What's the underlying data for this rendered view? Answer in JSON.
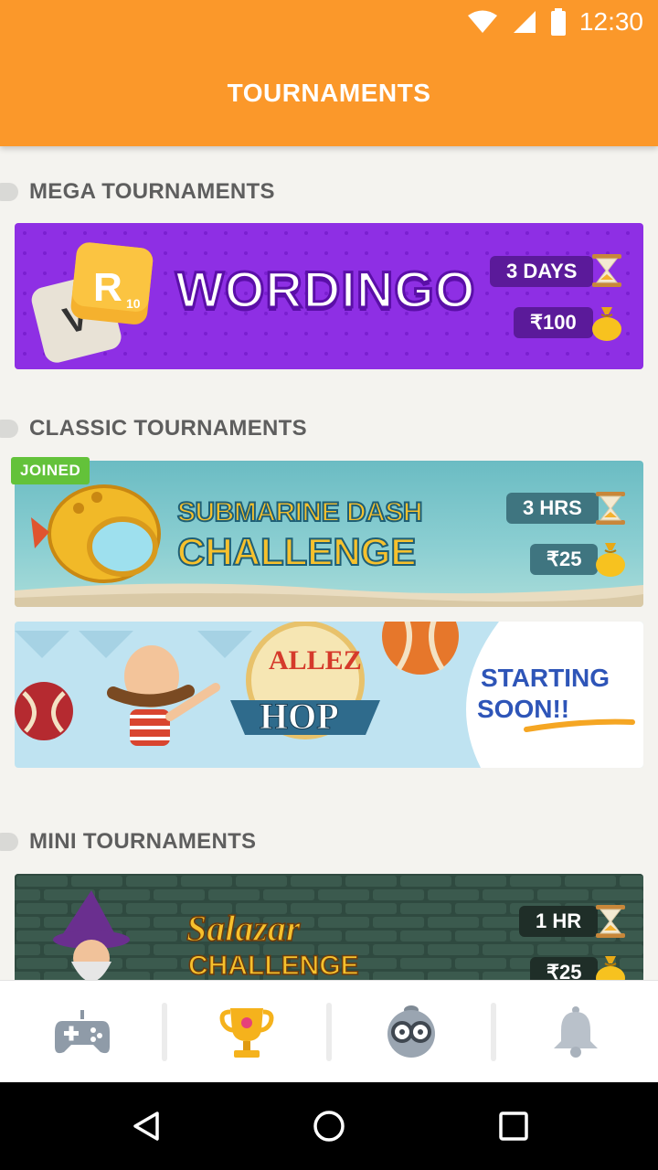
{
  "status_bar": {
    "time": "12:30"
  },
  "app_bar": {
    "title": "TOURNAMENTS"
  },
  "sections": {
    "mega": {
      "title": "MEGA TOURNAMENTS"
    },
    "classic": {
      "title": "CLASSIC TOURNAMENTS"
    },
    "mini": {
      "title": "MINI TOURNAMENTS"
    }
  },
  "cards": {
    "wordingo": {
      "logo_text": "WORDINGO",
      "tile_letter": "R",
      "tile_score": "10",
      "duration": "3 DAYS",
      "prize": "₹100"
    },
    "submarine": {
      "badge": "JOINED",
      "title_line1": "SUBMARINE DASH",
      "title_line2": "CHALLENGE",
      "duration": "3 HRS",
      "prize": "₹25"
    },
    "allez_hop": {
      "title_line1": "ALLEZ",
      "title_line2": "HOP",
      "status_line1": "STARTING",
      "status_line2": "SOON!!"
    },
    "salazar": {
      "title_line1": "Salazar",
      "title_line2": "CHALLENGE",
      "duration": "1 HR",
      "prize": "₹25"
    }
  },
  "bottom_nav": {
    "items": [
      {
        "name": "games",
        "icon": "gamepad-icon"
      },
      {
        "name": "tournaments",
        "icon": "trophy-icon",
        "active": true
      },
      {
        "name": "profile",
        "icon": "avatar-glasses-icon"
      },
      {
        "name": "notifications",
        "icon": "bell-icon"
      }
    ]
  },
  "colors": {
    "accent": "#fb982a",
    "purple": "#8a2be2",
    "joined": "#63c23a"
  }
}
